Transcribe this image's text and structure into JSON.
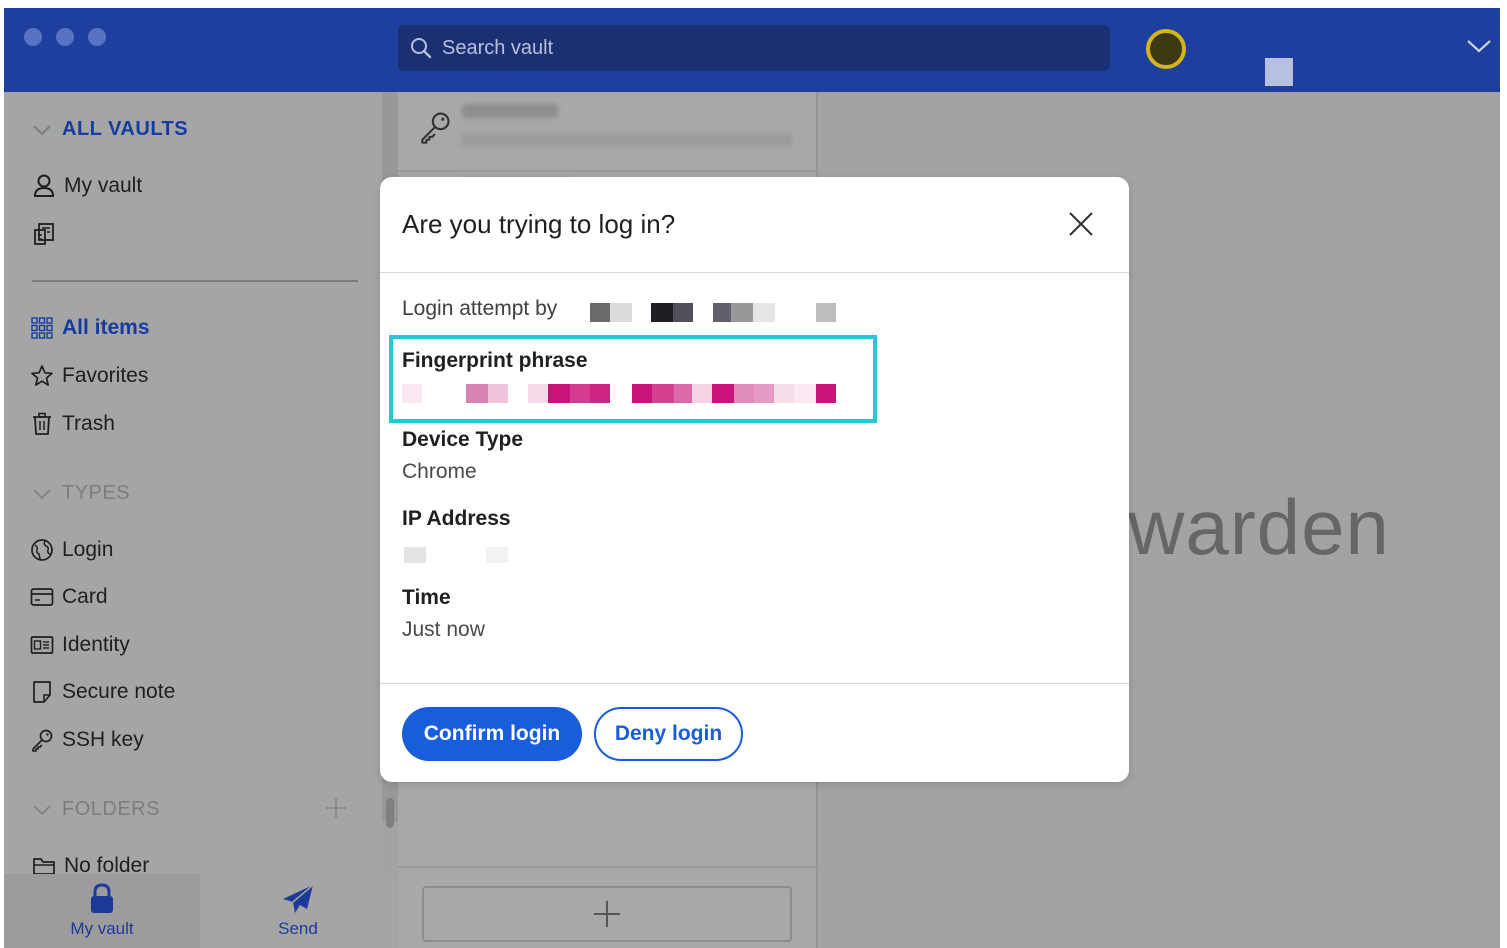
{
  "header": {
    "search_placeholder": "Search vault"
  },
  "sidebar": {
    "all_vaults": "ALL VAULTS",
    "my_vault": "My vault",
    "all_items": "All items",
    "favorites": "Favorites",
    "trash": "Trash",
    "types_heading": "TYPES",
    "types": [
      "Login",
      "Card",
      "Identity",
      "Secure note",
      "SSH key"
    ],
    "folders_heading": "FOLDERS",
    "no_folder": "No folder"
  },
  "bottom_tabs": {
    "my_vault": "My vault",
    "send": "Send"
  },
  "detail": {
    "logo_text": "warden"
  },
  "modal": {
    "title": "Are you trying to log in?",
    "login_attempt_label": "Login attempt by",
    "fingerprint_label": "Fingerprint phrase",
    "device_type_label": "Device Type",
    "device_type_value": "Chrome",
    "ip_label": "IP Address",
    "time_label": "Time",
    "time_value": "Just now",
    "confirm_label": "Confirm login",
    "deny_label": "Deny login"
  },
  "colors": {
    "brand_blue": "#175ddc",
    "header_blue": "#1f3f9e",
    "highlight_cyan": "#21c9d8",
    "fingerprint_pink": "#c8147a"
  }
}
